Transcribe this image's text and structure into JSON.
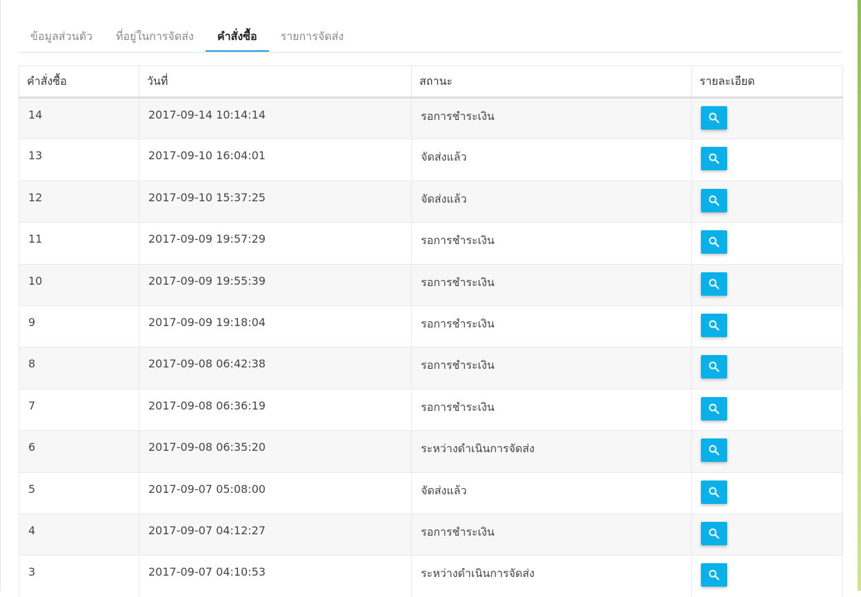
{
  "tabs": [
    {
      "label": "ข้อมูลส่วนตัว",
      "active": false
    },
    {
      "label": "ที่อยู่ในการจัดส่ง",
      "active": false
    },
    {
      "label": "คำสั่งซื้อ",
      "active": true
    },
    {
      "label": "รายการจัดส่ง",
      "active": false
    }
  ],
  "table": {
    "headers": {
      "order": "คำสั่งซื้อ",
      "date": "วันที่",
      "status": "สถานะ",
      "details": "รายละเอียด"
    },
    "rows": [
      {
        "order": "14",
        "date": "2017-09-14 10:14:14",
        "status": "รอการชำระเงิน"
      },
      {
        "order": "13",
        "date": "2017-09-10 16:04:01",
        "status": "จัดส่งแล้ว"
      },
      {
        "order": "12",
        "date": "2017-09-10 15:37:25",
        "status": "จัดส่งแล้ว"
      },
      {
        "order": "11",
        "date": "2017-09-09 19:57:29",
        "status": "รอการชำระเงิน"
      },
      {
        "order": "10",
        "date": "2017-09-09 19:55:39",
        "status": "รอการชำระเงิน"
      },
      {
        "order": "9",
        "date": "2017-09-09 19:18:04",
        "status": "รอการชำระเงิน"
      },
      {
        "order": "8",
        "date": "2017-09-08 06:42:38",
        "status": "รอการชำระเงิน"
      },
      {
        "order": "7",
        "date": "2017-09-08 06:36:19",
        "status": "รอการชำระเงิน"
      },
      {
        "order": "6",
        "date": "2017-09-08 06:35:20",
        "status": "ระหว่างดำเนินการจัดส่ง"
      },
      {
        "order": "5",
        "date": "2017-09-07 05:08:00",
        "status": "จัดส่งแล้ว"
      },
      {
        "order": "4",
        "date": "2017-09-07 04:12:27",
        "status": "รอการชำระเงิน"
      },
      {
        "order": "3",
        "date": "2017-09-07 04:10:53",
        "status": "ระหว่างดำเนินการจัดส่ง"
      }
    ]
  },
  "icons": {
    "view": "search-icon"
  },
  "colors": {
    "accent": "#1e9be0",
    "button": "#0ab1e8",
    "frame": "#8bc34a"
  }
}
